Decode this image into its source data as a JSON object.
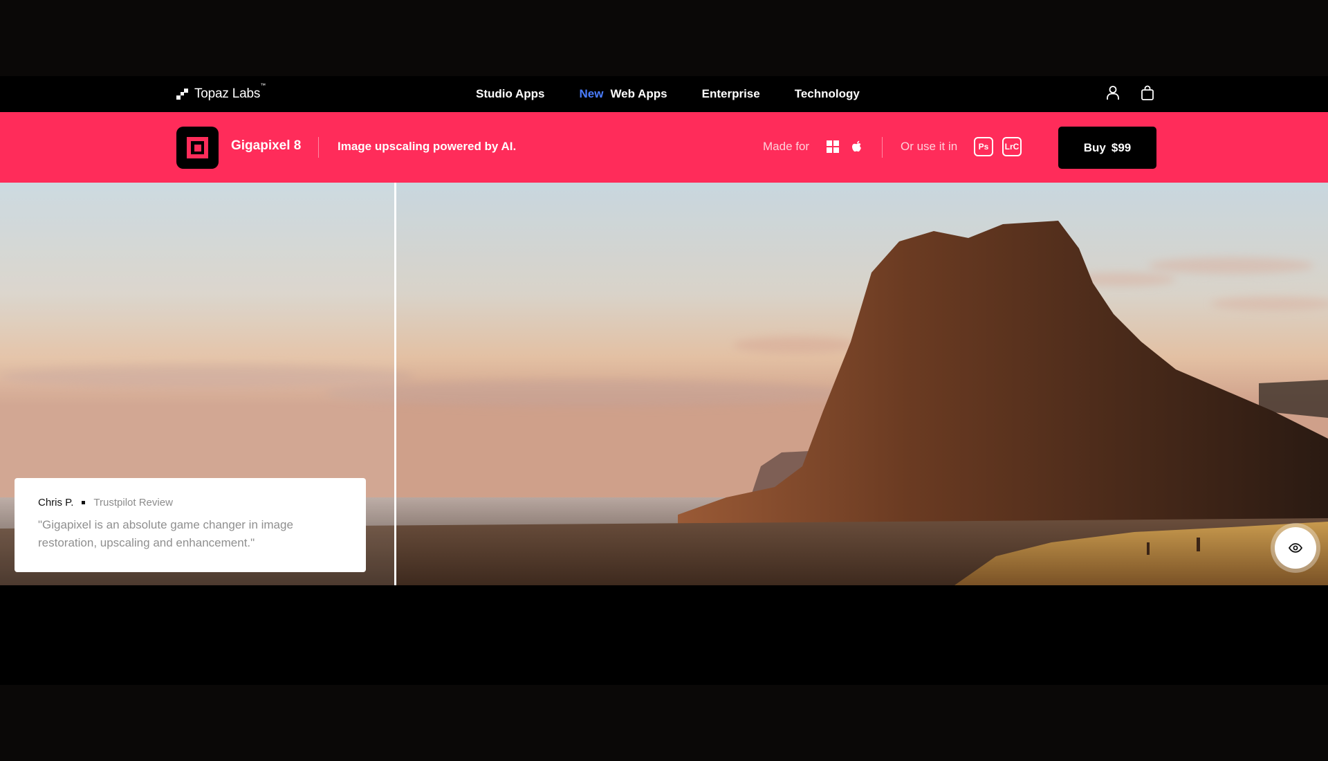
{
  "nav": {
    "logo_text": "Topaz Labs",
    "logo_tm": "™",
    "links": [
      "Studio Apps",
      "Web Apps",
      "Enterprise",
      "Technology"
    ],
    "new_tag": "New",
    "icons": [
      "user-icon",
      "shopping-bag-icon"
    ]
  },
  "product_bar": {
    "name": "Gigapixel 8",
    "tagline": "Image upscaling powered by AI.",
    "made_for_label": "Made for",
    "platforms": [
      "windows-icon",
      "apple-icon"
    ],
    "use_in_label": "Or use it in",
    "plugins": [
      "Ps",
      "LrC"
    ],
    "buy_label": "Buy",
    "price": "$99",
    "brand_color": "#ff2c5a"
  },
  "hero": {
    "review": {
      "reviewer": "Chris P.",
      "source": "Trustpilot Review",
      "text": "\"Gigapixel is an absolute game changer in image restoration, upscaling and enhancement.\""
    },
    "compare_icon": "eye-icon"
  }
}
